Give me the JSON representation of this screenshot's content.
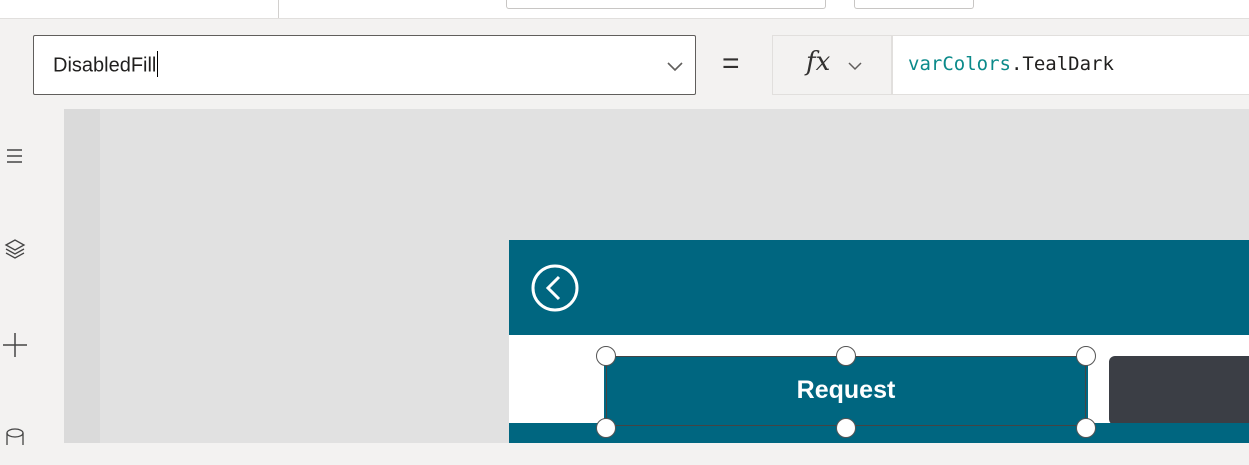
{
  "formula_bar": {
    "property": "DisabledFill",
    "equals": "=",
    "fx_label": "fx",
    "formula_object": "varColors",
    "formula_separator": ".",
    "formula_member": "TealDark"
  },
  "left_rail": {
    "icons": [
      "hamburger-menu-icon",
      "layers-icon",
      "add-icon",
      "data-icon"
    ]
  },
  "app_preview": {
    "header_color": "#006680",
    "request_button_label": "Request",
    "request_button_color": "#006680",
    "secondary_button_color": "#3b3e45"
  },
  "colors": {
    "formula_identifier": "#0b8a8a",
    "canvas_background": "#e1e1e1"
  }
}
